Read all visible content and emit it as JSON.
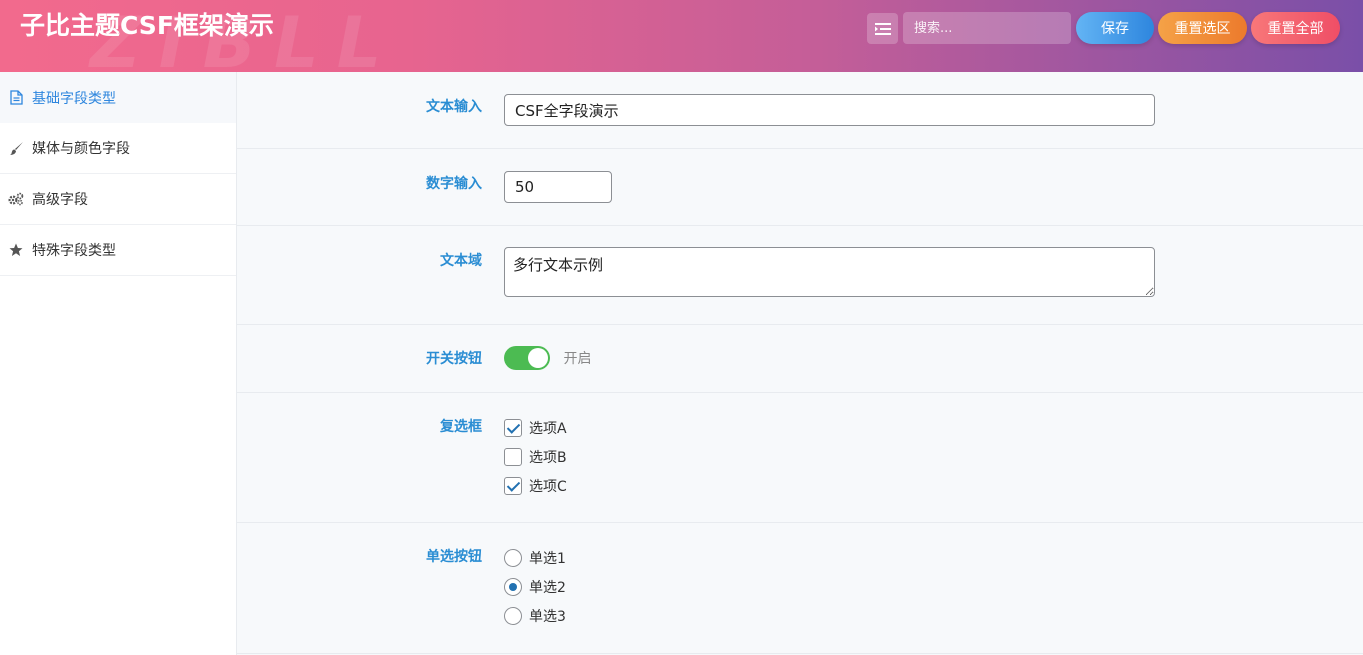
{
  "header": {
    "title": "子比主题CSF框架演示",
    "watermark": "ZIBLL",
    "search_placeholder": "搜索...",
    "save_label": "保存",
    "reset_section_label": "重置选区",
    "reset_all_label": "重置全部"
  },
  "sidebar": {
    "items": [
      {
        "label": "基础字段类型",
        "icon": "document-icon",
        "active": true
      },
      {
        "label": "媒体与颜色字段",
        "icon": "brush-icon",
        "active": false
      },
      {
        "label": "高级字段",
        "icon": "gears-icon",
        "active": false
      },
      {
        "label": "特殊字段类型",
        "icon": "star-icon",
        "active": false
      }
    ]
  },
  "fields": {
    "text": {
      "label": "文本输入",
      "value": "CSF全字段演示"
    },
    "number": {
      "label": "数字输入",
      "value": "50"
    },
    "textarea": {
      "label": "文本域",
      "value": "多行文本示例"
    },
    "switch": {
      "label": "开关按钮",
      "state_text": "开启",
      "on": true
    },
    "checkbox": {
      "label": "复选框",
      "options": [
        {
          "label": "选项A",
          "checked": true
        },
        {
          "label": "选项B",
          "checked": false
        },
        {
          "label": "选项C",
          "checked": true
        }
      ]
    },
    "radio": {
      "label": "单选按钮",
      "options": [
        {
          "label": "单选1",
          "checked": false
        },
        {
          "label": "单选2",
          "checked": true
        },
        {
          "label": "单选3",
          "checked": false
        }
      ]
    }
  },
  "colors": {
    "accent_blue": "#2e86de",
    "label_blue": "#2a8dd3",
    "toggle_green": "#4cbb52"
  }
}
